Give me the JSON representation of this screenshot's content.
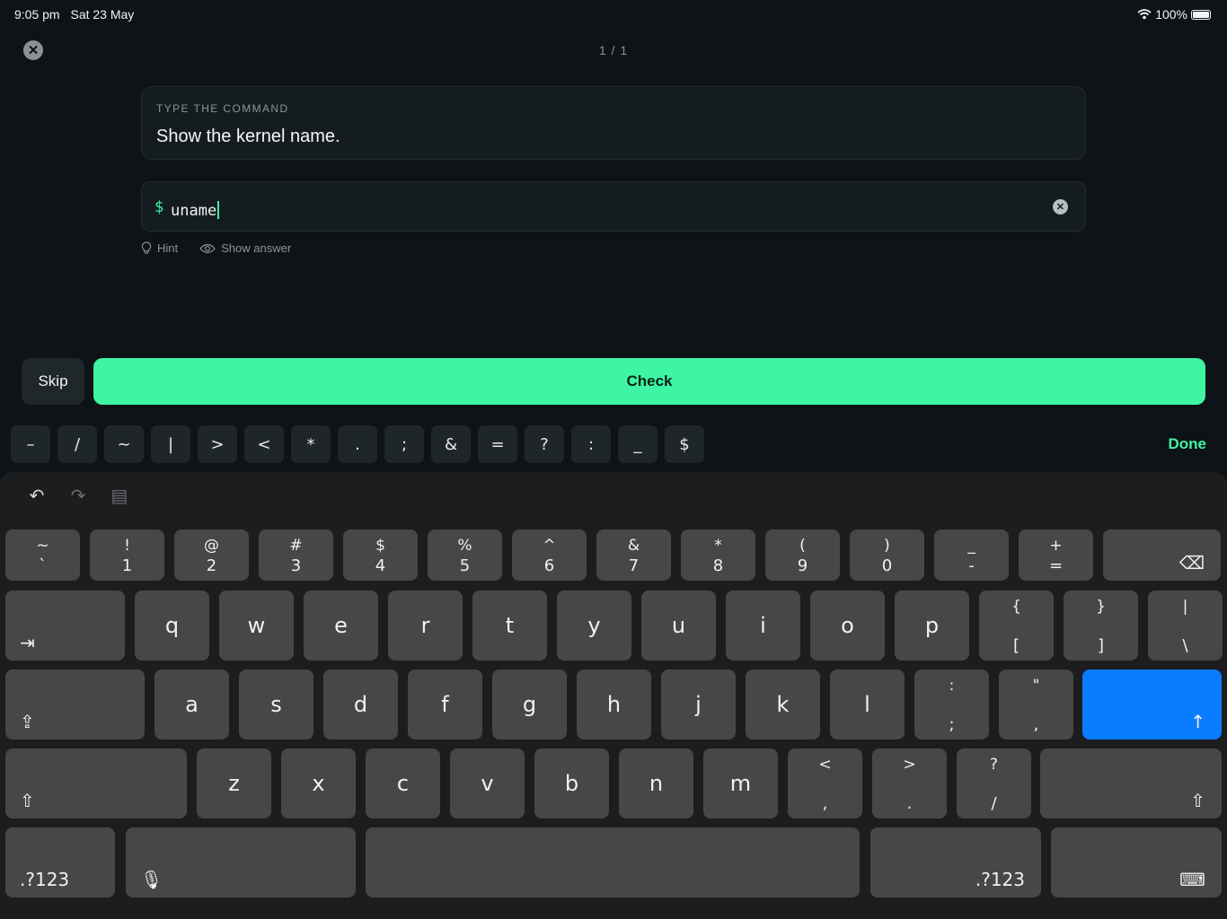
{
  "status": {
    "time": "9:05 pm",
    "date": "Sat 23 May",
    "battery": "100%"
  },
  "header": {
    "counter": "1 / 1"
  },
  "prompt": {
    "label": "TYPE THE COMMAND",
    "text": "Show the kernel name."
  },
  "terminal": {
    "prompt_symbol": "$",
    "value": "uname"
  },
  "links": {
    "hint": "Hint",
    "show_answer": "Show answer"
  },
  "actions": {
    "skip": "Skip",
    "check": "Check",
    "done": "Done"
  },
  "symbol_bar": [
    "–",
    "/",
    "~",
    "|",
    ">",
    "<",
    "*",
    ".",
    ";",
    "&",
    "=",
    "?",
    ":",
    "_",
    "$"
  ],
  "keyboard": {
    "number_row": [
      {
        "top": "~",
        "bottom": "`"
      },
      {
        "top": "!",
        "bottom": "1"
      },
      {
        "top": "@",
        "bottom": "2"
      },
      {
        "top": "#",
        "bottom": "3"
      },
      {
        "top": "$",
        "bottom": "4"
      },
      {
        "top": "%",
        "bottom": "5"
      },
      {
        "top": "^",
        "bottom": "6"
      },
      {
        "top": "&",
        "bottom": "7"
      },
      {
        "top": "*",
        "bottom": "8"
      },
      {
        "top": "(",
        "bottom": "9"
      },
      {
        "top": ")",
        "bottom": "0"
      },
      {
        "top": "_",
        "bottom": "-"
      },
      {
        "top": "+",
        "bottom": "="
      }
    ],
    "row_q": [
      "q",
      "w",
      "e",
      "r",
      "t",
      "y",
      "u",
      "i",
      "o",
      "p"
    ],
    "row_q_symbols": [
      {
        "top": "{",
        "bottom": "["
      },
      {
        "top": "}",
        "bottom": "]"
      },
      {
        "top": "|",
        "bottom": "\\"
      }
    ],
    "row_a": [
      "a",
      "s",
      "d",
      "f",
      "g",
      "h",
      "j",
      "k",
      "l"
    ],
    "row_a_symbols": [
      {
        "top": ":",
        "bottom": ";"
      },
      {
        "top": "\"",
        "bottom": ","
      }
    ],
    "row_z": [
      "z",
      "x",
      "c",
      "v",
      "b",
      "n",
      "m"
    ],
    "row_z_symbols": [
      {
        "top": "<",
        "bottom": ","
      },
      {
        "top": ">",
        "bottom": "."
      },
      {
        "top": "?",
        "bottom": "/"
      }
    ],
    "numbers_label": ".?123",
    "icons": [
      "undo-icon",
      "redo-icon",
      "clipboard-icon",
      "delete-icon",
      "tab-icon",
      "caps-lock-icon",
      "return-icon",
      "shift-icon",
      "microphone-icon",
      "keyboard-dismiss-icon"
    ]
  }
}
